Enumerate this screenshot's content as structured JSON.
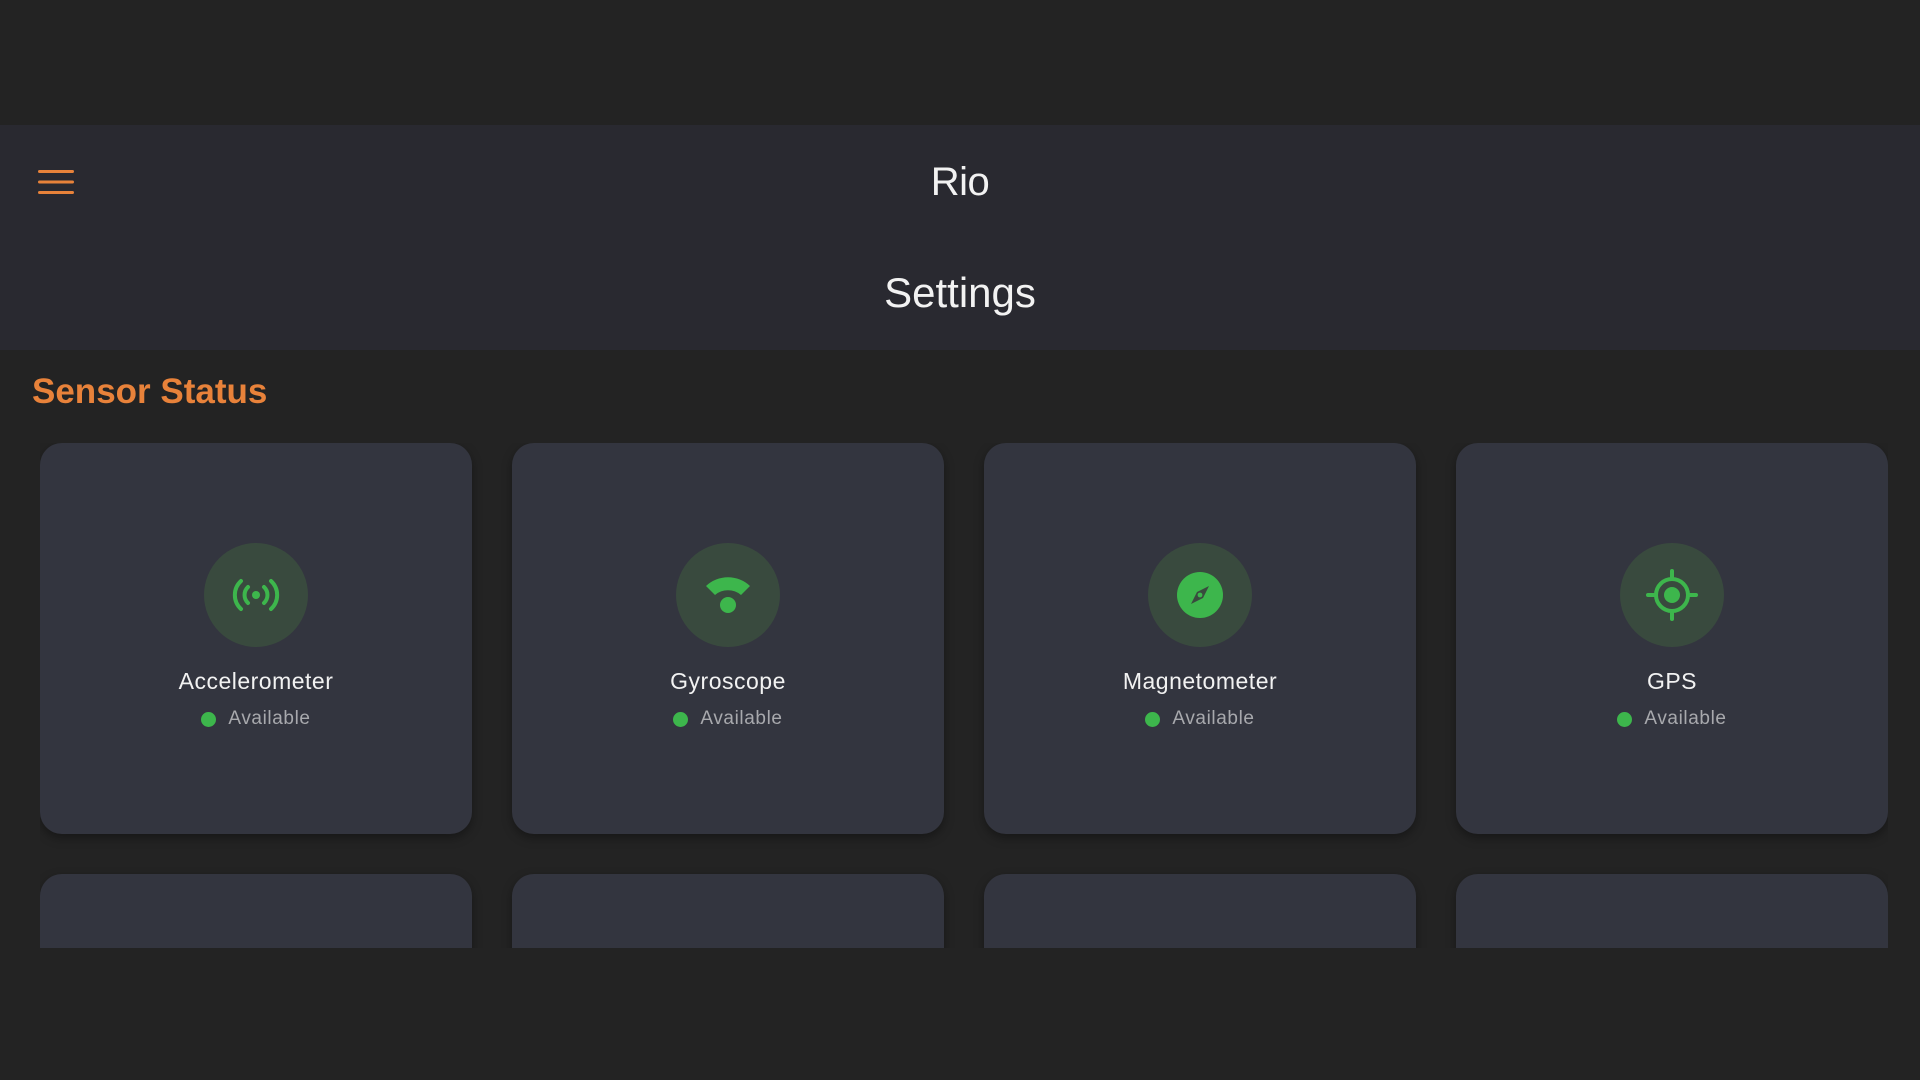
{
  "app": {
    "title": "Rio",
    "menu_icon": "hamburger-menu-icon",
    "accent_color": "#e8823a"
  },
  "page": {
    "title": "Settings"
  },
  "section": {
    "title": "Sensor Status"
  },
  "status_color": "#3db64c",
  "sensors": [
    {
      "name": "Accelerometer",
      "status": "Available",
      "icon": "sensors-icon"
    },
    {
      "name": "Gyroscope",
      "status": "Available",
      "icon": "gyroscope-icon"
    },
    {
      "name": "Magnetometer",
      "status": "Available",
      "icon": "compass-icon"
    },
    {
      "name": "GPS",
      "status": "Available",
      "icon": "gps-fixed-icon"
    }
  ]
}
